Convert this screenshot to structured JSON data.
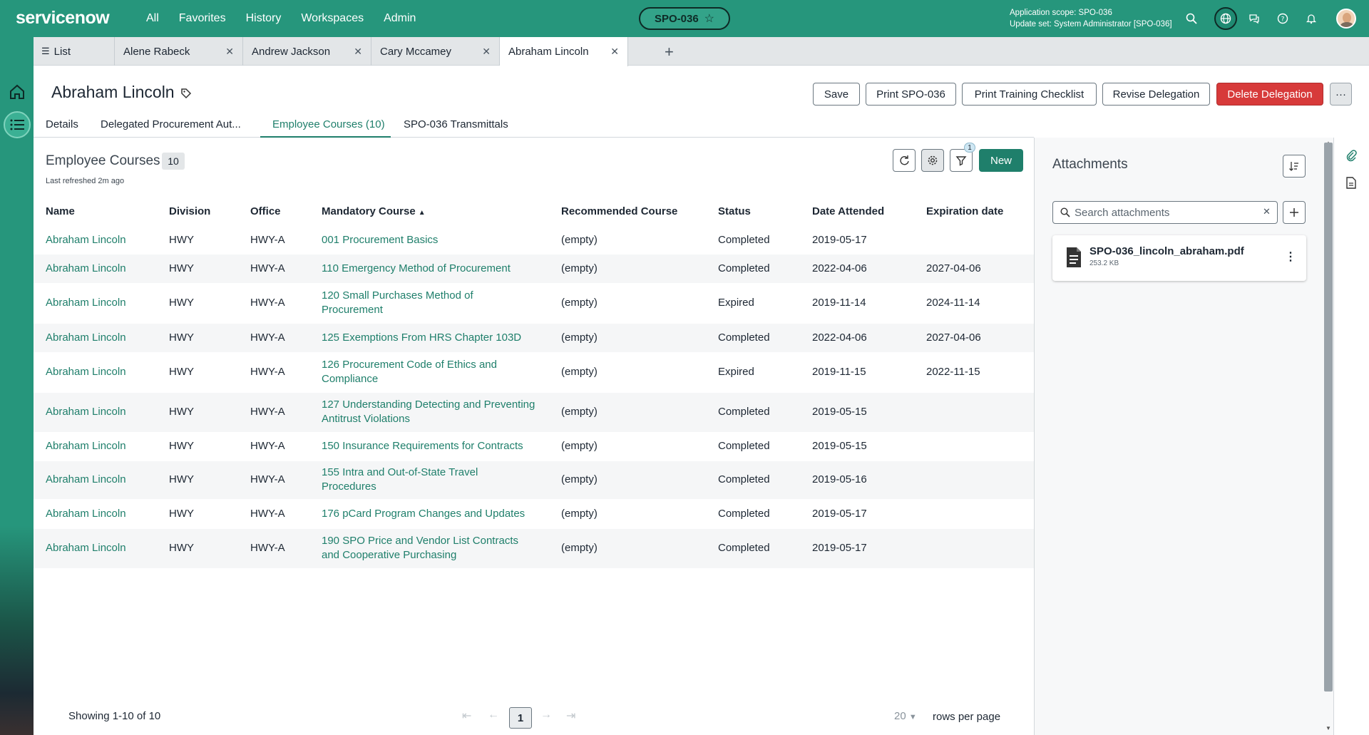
{
  "header": {
    "logo": "servicenow",
    "nav": [
      "All",
      "Favorites",
      "History",
      "Workspaces",
      "Admin"
    ],
    "scope_pill": "SPO-036",
    "scope_line1": "Application scope: SPO-036",
    "scope_line2": "Update set: System Administrator [SPO-036]",
    "icons": [
      "search-icon",
      "globe-icon",
      "chat-icon",
      "help-icon",
      "bell-icon",
      "avatar"
    ]
  },
  "tabs": [
    {
      "label": "List",
      "icon": "list-icon"
    },
    {
      "label": "Alene Rabeck"
    },
    {
      "label": "Andrew Jackson"
    },
    {
      "label": "Cary Mccamey"
    },
    {
      "label": "Abraham Lincoln",
      "active": true
    }
  ],
  "record": {
    "title": "Abraham Lincoln",
    "buttons": {
      "save": "Save",
      "print": "Print SPO-036",
      "checklist": "Print Training Checklist",
      "revise": "Revise Delegation",
      "delete": "Delete Delegation",
      "more": "···"
    },
    "form_tabs": [
      "Details",
      "Delegated Procurement Aut...",
      "Employee Courses (10)",
      "SPO-036 Transmittals"
    ],
    "active_form_tab": 2
  },
  "list": {
    "title": "Employee Courses",
    "count": "10",
    "refreshed": "Last refreshed 2m ago",
    "filter_count": "1",
    "new_label": "New",
    "columns": [
      "Name",
      "Division",
      "Office",
      "Mandatory Course",
      "Recommended Course",
      "Status",
      "Date Attended",
      "Expiration date"
    ],
    "sorted_column": "Mandatory Course",
    "rows": [
      {
        "name": "Abraham Lincoln",
        "division": "HWY",
        "office": "HWY-A",
        "course": "001 Procurement Basics",
        "recommended": "(empty)",
        "status": "Completed",
        "attended": "2019-05-17",
        "expiration": ""
      },
      {
        "name": "Abraham Lincoln",
        "division": "HWY",
        "office": "HWY-A",
        "course": "110 Emergency Method of Procurement",
        "recommended": "(empty)",
        "status": "Completed",
        "attended": "2022-04-06",
        "expiration": "2027-04-06"
      },
      {
        "name": "Abraham Lincoln",
        "division": "HWY",
        "office": "HWY-A",
        "course": "120 Small Purchases Method of Procurement",
        "recommended": "(empty)",
        "status": "Expired",
        "attended": "2019-11-14",
        "expiration": "2024-11-14"
      },
      {
        "name": "Abraham Lincoln",
        "division": "HWY",
        "office": "HWY-A",
        "course": "125 Exemptions From HRS Chapter 103D",
        "recommended": "(empty)",
        "status": "Completed",
        "attended": "2022-04-06",
        "expiration": "2027-04-06"
      },
      {
        "name": "Abraham Lincoln",
        "division": "HWY",
        "office": "HWY-A",
        "course": "126 Procurement Code of Ethics and Compliance",
        "recommended": "(empty)",
        "status": "Expired",
        "attended": "2019-11-15",
        "expiration": "2022-11-15"
      },
      {
        "name": "Abraham Lincoln",
        "division": "HWY",
        "office": "HWY-A",
        "course": "127 Understanding Detecting and Preventing Antitrust Violations",
        "recommended": "(empty)",
        "status": "Completed",
        "attended": "2019-05-15",
        "expiration": ""
      },
      {
        "name": "Abraham Lincoln",
        "division": "HWY",
        "office": "HWY-A",
        "course": "150 Insurance Requirements for Contracts",
        "recommended": "(empty)",
        "status": "Completed",
        "attended": "2019-05-15",
        "expiration": ""
      },
      {
        "name": "Abraham Lincoln",
        "division": "HWY",
        "office": "HWY-A",
        "course": "155 Intra and Out-of-State Travel Procedures",
        "recommended": "(empty)",
        "status": "Completed",
        "attended": "2019-05-16",
        "expiration": ""
      },
      {
        "name": "Abraham Lincoln",
        "division": "HWY",
        "office": "HWY-A",
        "course": "176 pCard Program Changes and Updates",
        "recommended": "(empty)",
        "status": "Completed",
        "attended": "2019-05-17",
        "expiration": ""
      },
      {
        "name": "Abraham Lincoln",
        "division": "HWY",
        "office": "HWY-A",
        "course": "190 SPO Price and Vendor List Contracts and Cooperative Purchasing",
        "recommended": "(empty)",
        "status": "Completed",
        "attended": "2019-05-17",
        "expiration": ""
      }
    ],
    "showing": "Showing 1-10 of 10",
    "current_page": "1",
    "rows_per_page": "20",
    "rows_per_page_label": "rows per page"
  },
  "attachments": {
    "title": "Attachments",
    "search_placeholder": "Search attachments",
    "files": [
      {
        "name": "SPO-036_lincoln_abraham.pdf",
        "size": "253.2 KB"
      }
    ]
  },
  "colors": {
    "header": "#26967c",
    "accent": "#1f7f6b",
    "danger": "#d73a3a"
  }
}
